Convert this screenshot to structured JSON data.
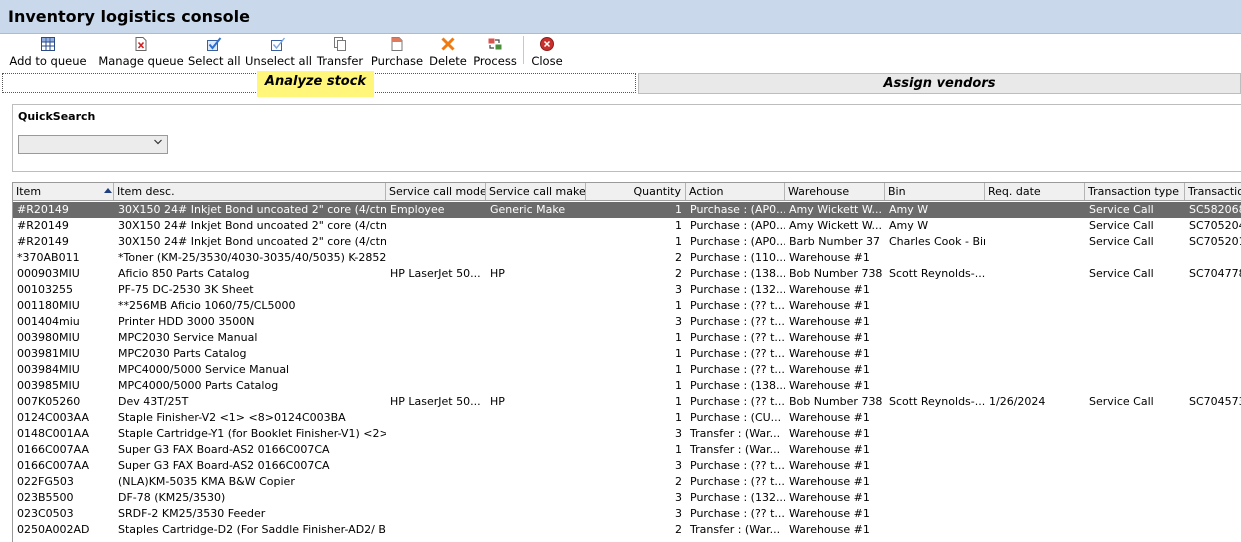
{
  "window": {
    "title": "Inventory logistics console"
  },
  "toolbar": [
    {
      "key": "add-to-queue",
      "label": "Add to queue",
      "icon": "grid-icon"
    },
    {
      "key": "manage-queue",
      "label": "Manage queue",
      "icon": "document-x-icon"
    },
    {
      "key": "select-all",
      "label": "Select all",
      "icon": "checkbox-checked-icon"
    },
    {
      "key": "unselect-all",
      "label": "Unselect all",
      "icon": "checkbox-unchecked-icon"
    },
    {
      "key": "transfer",
      "label": "Transfer",
      "icon": "copy-icon"
    },
    {
      "key": "purchase",
      "label": "Purchase",
      "icon": "document-icon"
    },
    {
      "key": "delete",
      "label": "Delete",
      "icon": "x-icon"
    },
    {
      "key": "process",
      "label": "Process",
      "icon": "process-icon"
    },
    {
      "key": "close",
      "label": "Close",
      "icon": "close-circle-icon"
    }
  ],
  "tabs": {
    "active": "Analyze stock",
    "other": "Assign vendors"
  },
  "quicksearch": {
    "label": "QuickSearch",
    "value": ""
  },
  "grid": {
    "columns": [
      "Item",
      "Item desc.",
      "Service call model",
      "Service call make",
      "Quantity",
      "Action",
      "Warehouse",
      "Bin",
      "Req. date",
      "Transaction type",
      "Transaction"
    ],
    "rows": [
      [
        "#R20149",
        "30X150 24# Inkjet Bond uncoated 2\" core (4/ctn)",
        "Employee",
        "Generic Make",
        "1",
        "Purchase : (AP0...",
        "Amy Wickett W...",
        "Amy W",
        "",
        "Service Call",
        "SC582068"
      ],
      [
        "#R20149",
        "30X150 24# Inkjet Bond uncoated 2\" core (4/ctn)",
        "",
        "",
        "1",
        "Purchase : (AP0...",
        "Amy Wickett W...",
        "Amy W",
        "",
        "Service Call",
        "SC705204"
      ],
      [
        "#R20149",
        "30X150 24# Inkjet Bond uncoated 2\" core (4/ctn)",
        "",
        "",
        "1",
        "Purchase : (AP0...",
        "Barb Number 37",
        "Charles Cook - Bin",
        "",
        "Service Call",
        "SC705201"
      ],
      [
        "*370AB011",
        "*Toner (KM-25/3530/4030-3035/40/5035) K-28526 ...",
        "",
        "",
        "2",
        "Purchase : (110...",
        "Warehouse #1",
        "",
        "",
        "",
        ""
      ],
      [
        "000903MIU",
        "Aficio 850 Parts Catalog",
        "HP LaserJet 50...",
        "HP",
        "2",
        "Purchase : (138...",
        "Bob Number 738",
        "Scott Reynolds-...",
        "",
        "Service Call",
        "SC704778"
      ],
      [
        "00103255",
        "PF-75 DC-2530 3K Sheet",
        "",
        "",
        "3",
        "Purchase : (132...",
        "Warehouse #1",
        "",
        "",
        "",
        ""
      ],
      [
        "001180MIU",
        "**256MB Aficio 1060/75/CL5000",
        "",
        "",
        "1",
        "Purchase : (?? t...",
        "Warehouse #1",
        "",
        "",
        "",
        ""
      ],
      [
        "001404miu",
        "Printer HDD 3000 3500N",
        "",
        "",
        "3",
        "Purchase : (?? t...",
        "Warehouse #1",
        "",
        "",
        "",
        ""
      ],
      [
        "003980MIU",
        "MPC2030 Service Manual",
        "",
        "",
        "1",
        "Purchase : (?? t...",
        "Warehouse #1",
        "",
        "",
        "",
        ""
      ],
      [
        "003981MIU",
        "MPC2030 Parts Catalog",
        "",
        "",
        "1",
        "Purchase : (?? t...",
        "Warehouse #1",
        "",
        "",
        "",
        ""
      ],
      [
        "003984MIU",
        "MPC4000/5000 Service Manual",
        "",
        "",
        "1",
        "Purchase : (?? t...",
        "Warehouse #1",
        "",
        "",
        "",
        ""
      ],
      [
        "003985MIU",
        "MPC4000/5000 Parts Catalog",
        "",
        "",
        "1",
        "Purchase : (138...",
        "Warehouse #1",
        "",
        "",
        "",
        ""
      ],
      [
        "007K05260",
        "Dev 43T/25T",
        "HP LaserJet 50...",
        "HP",
        "1",
        "Purchase : (?? t...",
        "Bob Number 738",
        "Scott Reynolds-...",
        "1/26/2024",
        "Service Call",
        "SC704573"
      ],
      [
        "0124C003AA",
        "Staple Finisher-V2 <1> <8>0124C003BA",
        "",
        "",
        "1",
        "Purchase : (CU...",
        "Warehouse #1",
        "",
        "",
        "",
        ""
      ],
      [
        "0148C001AA",
        "Staple Cartridge-Y1 (for Booklet Finisher-V1) <2>",
        "",
        "",
        "3",
        "Transfer : (War...",
        "Warehouse #1",
        "",
        "",
        "",
        ""
      ],
      [
        "0166C007AA",
        "Super G3 FAX Board-AS2 0166C007CA",
        "",
        "",
        "1",
        "Transfer : (War...",
        "Warehouse #1",
        "",
        "",
        "",
        ""
      ],
      [
        "0166C007AA",
        "Super G3 FAX Board-AS2 0166C007CA",
        "",
        "",
        "3",
        "Purchase : (?? t...",
        "Warehouse #1",
        "",
        "",
        "",
        ""
      ],
      [
        "022FG503",
        "(NLA)KM-5035 KMA B&W Copier",
        "",
        "",
        "2",
        "Purchase : (?? t...",
        "Warehouse #1",
        "",
        "",
        "",
        ""
      ],
      [
        "023B5500",
        "DF-78 (KM25/3530)",
        "",
        "",
        "3",
        "Purchase : (132...",
        "Warehouse #1",
        "",
        "",
        "",
        ""
      ],
      [
        "023C0503",
        "SRDF-2 KM25/3530 Feeder",
        "",
        "",
        "3",
        "Purchase : (?? t...",
        "Warehouse #1",
        "",
        "",
        "",
        ""
      ],
      [
        "0250A002AD",
        "Staples Cartridge-D2 (For Saddle Finisher-AD2/ Boo...",
        "",
        "",
        "2",
        "Transfer : (War...",
        "Warehouse #1",
        "",
        "",
        "",
        ""
      ]
    ]
  }
}
